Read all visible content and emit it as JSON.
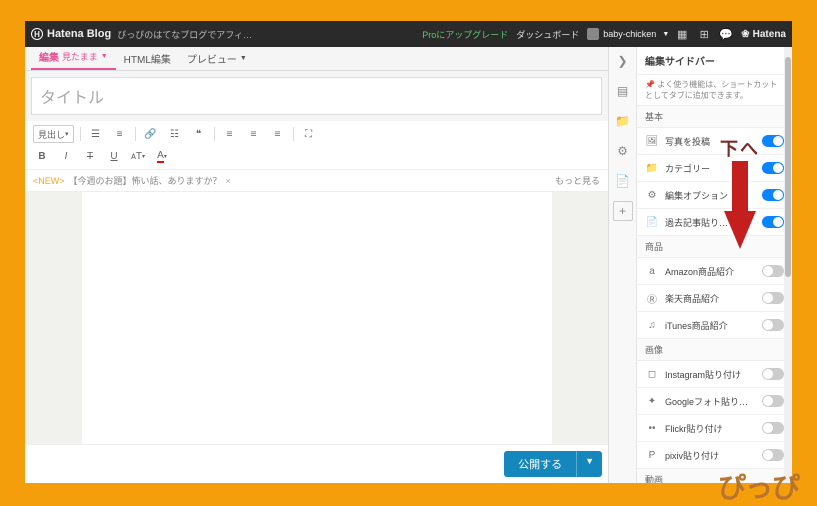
{
  "topbar": {
    "logo": "Hatena Blog",
    "breadcrumb": "ぴっぴのはてなブログでアフィ…",
    "pro_link": "Proにアップグレード",
    "dashboard": "ダッシュボード",
    "username": "baby-chicken",
    "hatena": "Hatena"
  },
  "tabs": {
    "edit": "編集",
    "edit_mode": "見たまま",
    "html": "HTML編集",
    "preview": "プレビュー"
  },
  "title_placeholder": "タイトル",
  "toolbar": {
    "heading": "見出し"
  },
  "notice": {
    "new": "<NEW>",
    "text": "【今週のお題】怖い話、ありますか？",
    "more": "もっと見る"
  },
  "publish": "公開する",
  "sidebar": {
    "title": "編集サイドバー",
    "hint": "よく使う機能は、ショートカットとしてタブに追加できます。",
    "sections": {
      "basic": "基本",
      "shop": "商品",
      "image": "画像",
      "video": "動画"
    },
    "items": {
      "photo": "写真を投稿",
      "category": "カテゴリー",
      "options": "編集オプション",
      "past": "過去記事貼り…",
      "amazon": "Amazon商品紹介",
      "rakuten": "楽天商品紹介",
      "itunes": "iTunes商品紹介",
      "instagram": "Instagram貼り付け",
      "gphoto": "Googleフォト貼り付け",
      "flickr": "Flickr貼り付け",
      "pixiv": "pixiv貼り付け"
    }
  },
  "annot": {
    "arrow_label": "下へ",
    "pippi": "ぴっぴ"
  }
}
